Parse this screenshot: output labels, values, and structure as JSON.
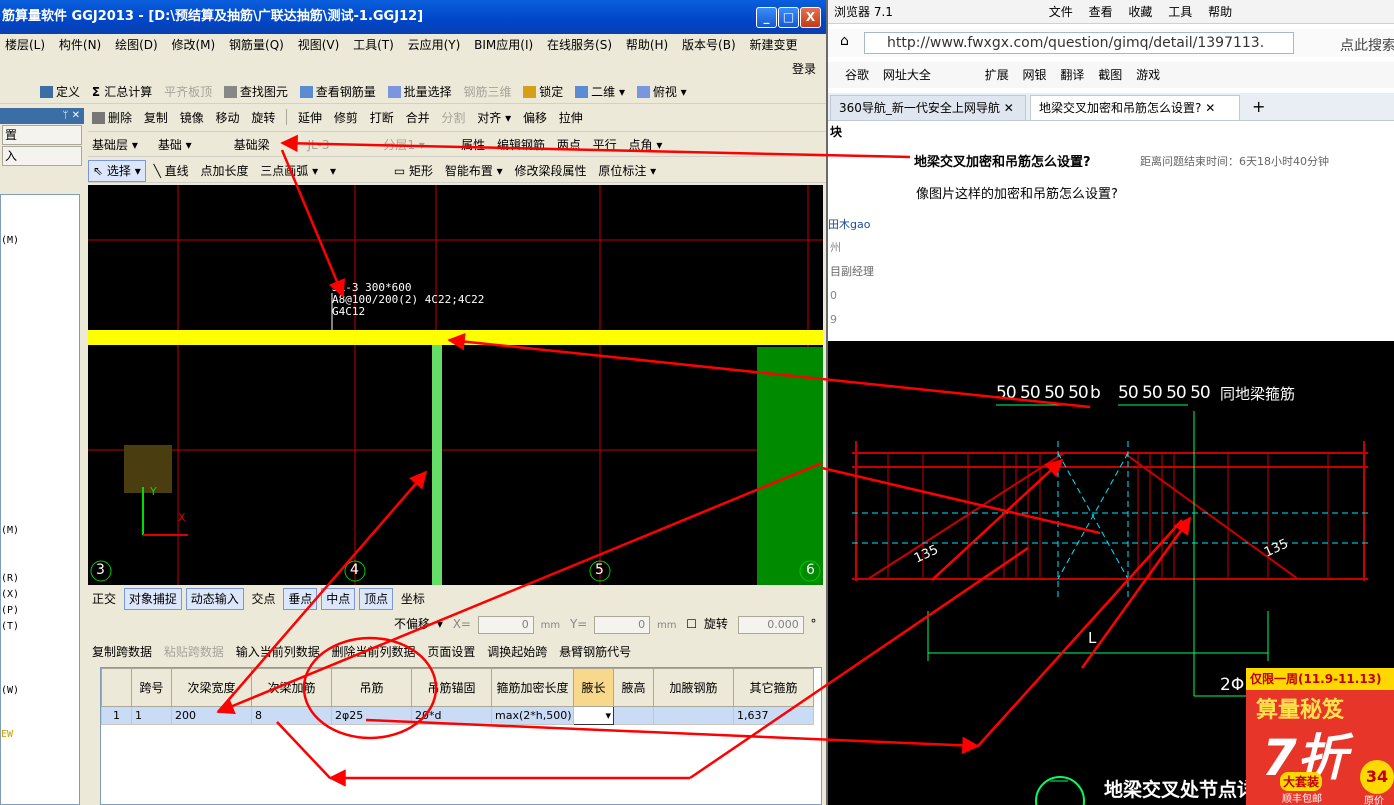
{
  "app": {
    "title": "筋算量软件 GGJ2013 - [D:\\预结算及抽筋\\广联达抽筋\\测试-1.GGJ12]",
    "window_buttons": [
      "_",
      "□",
      "X"
    ],
    "login": "登录",
    "menu": [
      "楼层(L)",
      "构件(N)",
      "绘图(D)",
      "修改(M)",
      "钢筋量(Q)",
      "视图(V)",
      "工具(T)",
      "云应用(Y)",
      "BIM应用(I)",
      "在线服务(S)",
      "帮助(H)",
      "版本号(B)",
      "新建变更"
    ],
    "toolbar1": {
      "define": "定义",
      "sum": "汇总计算",
      "slab": "平齐板顶",
      "find": "查找图元",
      "view_rebar": "查看钢筋量",
      "batch": "批量选择",
      "rebar3d": "钢筋三维",
      "lock": "锁定",
      "view2d": "二维",
      "persp": "俯视"
    },
    "toolbar2": {
      "delete": "删除",
      "copy": "复制",
      "mirror": "镜像",
      "move": "移动",
      "rotate": "旋转",
      "extend": "延伸",
      "trim": "修剪",
      "break": "打断",
      "merge": "合并",
      "split": "分割",
      "align": "对齐",
      "offset": "偏移",
      "stretch": "拉伸"
    },
    "toolbar3": {
      "layer": "基础层",
      "category": "基础",
      "type": "基础梁",
      "element": "JL-3",
      "sublayer": "分层1",
      "props": "属性",
      "edit_rebar": "编辑钢筋",
      "two_point": "两点",
      "parallel": "平行",
      "point_angle": "点角"
    },
    "toolbar4": {
      "select": "选择",
      "line": "直线",
      "point_len": "点加长度",
      "three_arc": "三点画弧",
      "rect": "矩形",
      "smart": "智能布置",
      "modify_span": "修改梁段属性",
      "orig_mark": "原位标注"
    },
    "panel": {
      "title": "置",
      "btn2": "入",
      "list_keys": [
        "(M)",
        "(R)",
        "(X)",
        "(P)",
        "(T)",
        "(W)",
        "EW"
      ]
    },
    "canvas": {
      "beam_label_1": "JL-3 300*600",
      "beam_label_2": "A8@100/200(2) 4C22;4C22",
      "beam_label_3": "G4C12",
      "axes": [
        "3",
        "4",
        "5",
        "6"
      ],
      "axis_y": "Y",
      "axis_x": "X"
    },
    "snapbar": {
      "ortho": "正交",
      "snap": "对象捕捉",
      "dyn": "动态输入",
      "intersect": "交点",
      "perp": "垂点",
      "mid": "中点",
      "vertex": "顶点",
      "coord": "坐标"
    },
    "coordbar": {
      "offset": "不偏移",
      "x_label": "X=",
      "x_val": "0",
      "y_label": "Y=",
      "y_val": "0",
      "unit": "mm",
      "rotate": "旋转",
      "rot_val": "0.000",
      "deg": "°"
    },
    "gridtb": {
      "copy_span": "复制跨数据",
      "paste_span": "粘贴跨数据",
      "input_col": "输入当前列数据",
      "del_col": "删除当前列数据",
      "page_setup": "页面设置",
      "swap_start": "调换起始跨",
      "cantilever": "悬臂钢筋代号"
    },
    "grid": {
      "headers": [
        "跨号",
        "次梁宽度",
        "次梁加筋",
        "吊筋",
        "吊筋锚固",
        "箍筋加密长度",
        "腋长",
        "腋高",
        "加腋钢筋",
        "其它箍筋"
      ],
      "rows": [
        {
          "no": "1",
          "cells": [
            "1",
            "200",
            "8",
            "2φ25",
            "20*d",
            "max(2*h,500)",
            "",
            "",
            "",
            "1,637"
          ]
        }
      ]
    }
  },
  "browser": {
    "title_tail": "浏览器 7.1",
    "menu": [
      "文件",
      "查看",
      "收藏",
      "工具",
      "帮助"
    ],
    "url": "http://www.fwxgx.com/question/gimq/detail/1397113.",
    "search_hint": "点此搜索",
    "favs": [
      "谷歌",
      "网址大全",
      "扩展",
      "网银",
      "翻译",
      "截图",
      "游戏"
    ],
    "tabs": [
      "360导航_新一代安全上网导航",
      "地梁交叉加密和吊筋怎么设置?"
    ],
    "question": {
      "title": "地梁交叉加密和吊筋怎么设置?",
      "timer": "距离问题结束时间：6天18小时40分钟",
      "body": "像图片这样的加密和吊筋怎么设置?",
      "user": "田木gao",
      "city": "州",
      "role": "目副经理",
      "num1": "0",
      "num2": "9",
      "side_char": "块"
    },
    "cad": {
      "dims_left": "50 50 50 50",
      "b": "b",
      "dims_right": "50 50 50 50",
      "note": "同地梁箍筋",
      "angle1": "135",
      "angle2": "135",
      "L": "L",
      "rebar": "2Φ",
      "footer": "地梁交叉处节点详图"
    },
    "ad": {
      "line1": "仅限一周(11.9-11.13)",
      "line2": "算量秘笈",
      "line3": "7折",
      "line4": "大套装",
      "line5": "顺丰包邮",
      "num": "34",
      "orig": "原价"
    }
  },
  "colors": {
    "title_blue": "#0a5fdc",
    "annot_red": "#ff0000",
    "beam_yellow": "#ffff00",
    "beam_green": "#66dd66",
    "cad_red": "#c80000",
    "cad_cyan": "#00e5ff"
  }
}
